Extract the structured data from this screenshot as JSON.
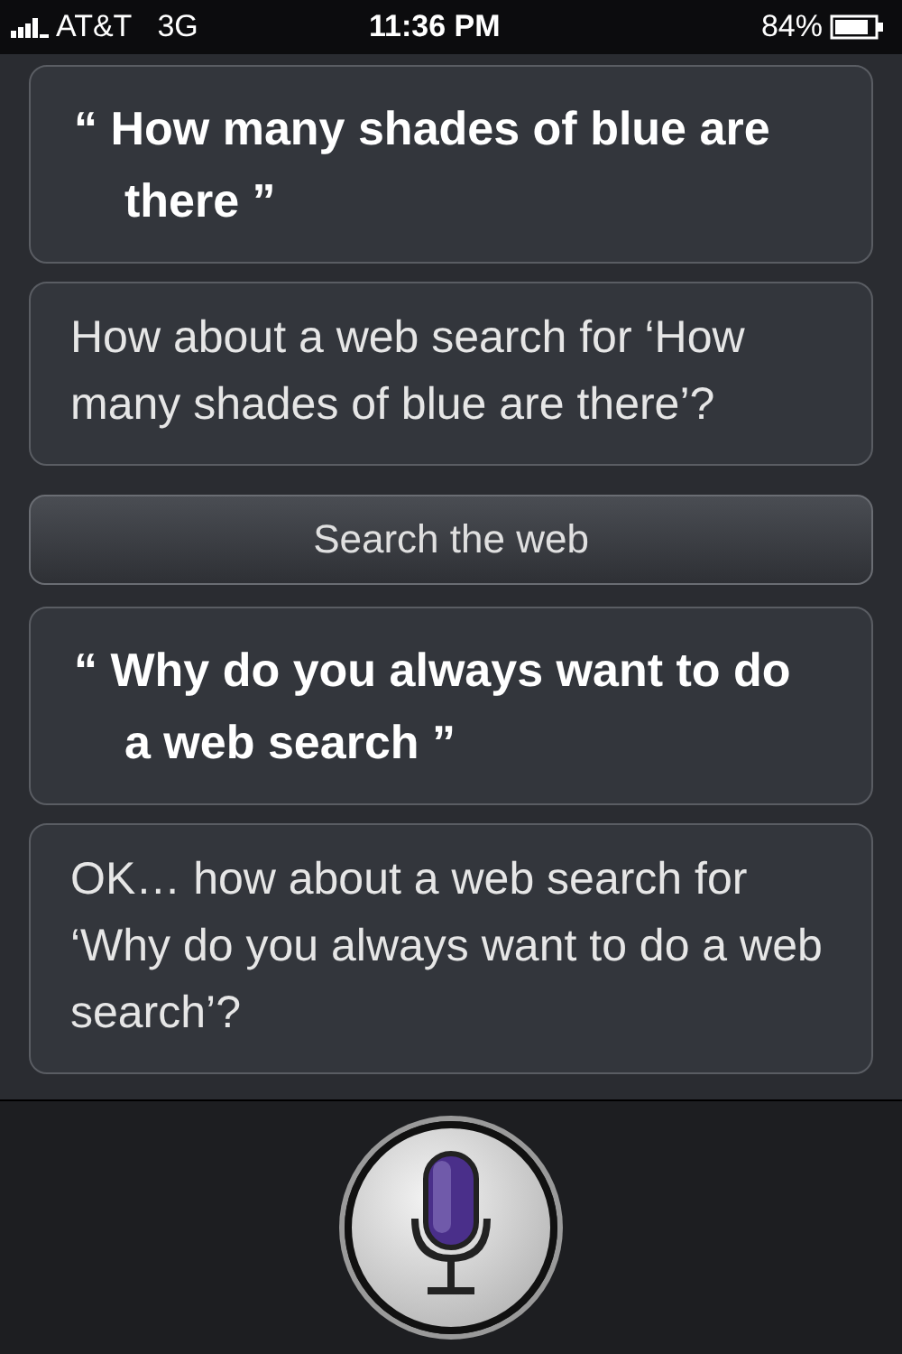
{
  "status_bar": {
    "carrier": "AT&T",
    "network": "3G",
    "time": "11:36 PM",
    "battery": "84%"
  },
  "conversation": [
    {
      "kind": "user",
      "text": "“ How many shades of blue are there ”"
    },
    {
      "kind": "assistant",
      "text": "How about a web search for ‘How many shades of blue are there’?"
    },
    {
      "kind": "action",
      "text": "Search the web"
    },
    {
      "kind": "user",
      "text": "“ Why do you always want to do a web search ”"
    },
    {
      "kind": "assistant",
      "text": "OK… how about a web search for ‘Why do you always want to do a web search’?"
    }
  ]
}
